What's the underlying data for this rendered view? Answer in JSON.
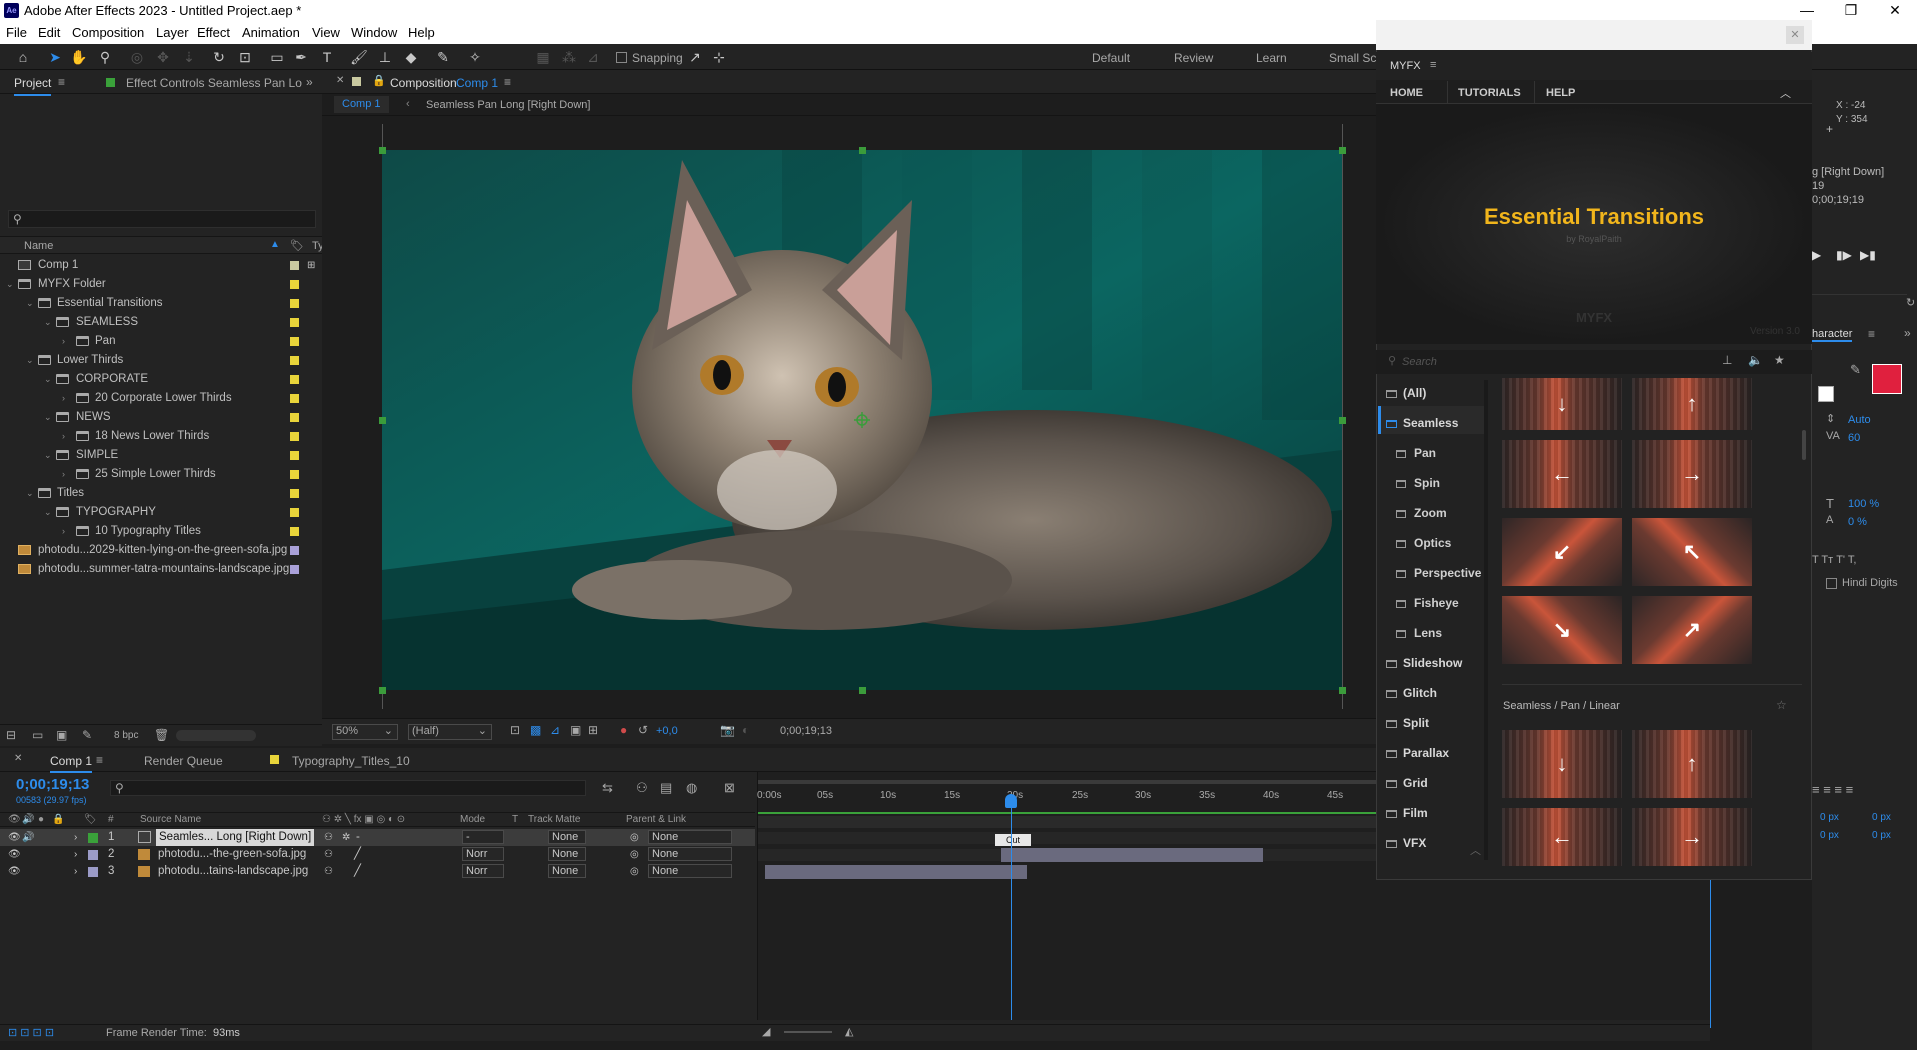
{
  "titlebar": {
    "title": "Adobe After Effects 2023 - Untitled Project.aep *",
    "logo": "Ae"
  },
  "menu": [
    "File",
    "Edit",
    "Composition",
    "Layer",
    "Effect",
    "Animation",
    "View",
    "Window",
    "Help"
  ],
  "toolbar": {
    "snapping": "Snapping",
    "workspaces": [
      "Default",
      "Review",
      "Learn",
      "Small Scr"
    ]
  },
  "project": {
    "tab_project": "Project",
    "tab_effect": "Effect Controls Seamless Pan Lo",
    "search_placeholder": "",
    "col_name": "Name",
    "col_type": "Ty",
    "items": [
      {
        "label": "Comp 1",
        "type": "comp"
      },
      {
        "label": "MYFX Folder",
        "type": "folder"
      },
      {
        "label": "Essential Transitions",
        "type": "folder"
      },
      {
        "label": "SEAMLESS",
        "type": "folder"
      },
      {
        "label": "Pan",
        "type": "folder"
      },
      {
        "label": "Lower Thirds",
        "type": "folder"
      },
      {
        "label": "CORPORATE",
        "type": "folder"
      },
      {
        "label": "20 Corporate Lower Thirds",
        "type": "folder"
      },
      {
        "label": "NEWS",
        "type": "folder"
      },
      {
        "label": "18 News Lower Thirds",
        "type": "folder"
      },
      {
        "label": "SIMPLE",
        "type": "folder"
      },
      {
        "label": "25 Simple Lower Thirds",
        "type": "folder"
      },
      {
        "label": "Titles",
        "type": "folder"
      },
      {
        "label": "TYPOGRAPHY",
        "type": "folder"
      },
      {
        "label": "10 Typography Titles",
        "type": "folder"
      },
      {
        "label": "photodu...2029-kitten-lying-on-the-green-sofa.jpg",
        "type": "image"
      },
      {
        "label": "photodu...summer-tatra-mountains-landscape.jpg",
        "type": "image"
      }
    ],
    "bpc": "8 bpc"
  },
  "composition": {
    "tab_label": "Composition",
    "tab_comp": "Comp 1",
    "breadcrumb_comp": "Comp 1",
    "breadcrumb_layer": "Seamless Pan Long [Right Down]",
    "zoom": "50%",
    "resolution": "(Half)",
    "exposure": "+0,0",
    "timecode": "0;00;19;13"
  },
  "timeline": {
    "tab_comp": "Comp 1",
    "tab_render": "Render Queue",
    "tab_typo": "Typography_Titles_10",
    "timecode": "0;00;19;13",
    "fps": "00583 (29.97 fps)",
    "col_source": "Source Name",
    "col_mode": "Mode",
    "col_t": "T",
    "col_track": "Track Matte",
    "col_parent": "Parent & Link",
    "ruler": [
      "0:00s",
      "05s",
      "10s",
      "15s",
      "20s",
      "25s",
      "30s",
      "35s",
      "40s",
      "45s"
    ],
    "layers": [
      {
        "num": "1",
        "name": "Seamles... Long [Right Down]",
        "mode": "-",
        "track": "None",
        "parent": "None",
        "color": "#3aa13a"
      },
      {
        "num": "2",
        "name": "photodu...-the-green-sofa.jpg",
        "mode": "Norr",
        "track": "None",
        "parent": "None",
        "color": "#9b9bc7"
      },
      {
        "num": "3",
        "name": "photodu...tains-landscape.jpg",
        "mode": "Norr",
        "track": "None",
        "parent": "None",
        "color": "#9b9bc7"
      }
    ],
    "render_label": "Frame Render Time:",
    "render_value": "93ms",
    "clip_label": "Cut"
  },
  "myfx": {
    "title": "MYFX",
    "nav": [
      "HOME",
      "TUTORIALS",
      "HELP"
    ],
    "banner_title": "Essential Transitions",
    "banner_sub": "by RoyalPaith",
    "banner_brand": "MYFX",
    "version": "Version 3.0",
    "search_placeholder": "Search",
    "categories": [
      "(All)",
      "Seamless",
      "Pan",
      "Spin",
      "Zoom",
      "Optics",
      "Perspective",
      "Fisheye",
      "Lens",
      "Slideshow",
      "Glitch",
      "Split",
      "Parallax",
      "Grid",
      "Film",
      "VFX"
    ],
    "section_label": "Seamless / Pan / Linear",
    "thumbs_top": [
      "↓",
      "↑",
      "←",
      "→",
      "↙",
      "↖",
      "↘",
      "↗"
    ],
    "thumbs_bottom": [
      "↓",
      "↑",
      "←",
      "→"
    ]
  },
  "right": {
    "coord_x": "X : -24",
    "coord_y": "Y : 354",
    "layer_frag": "g [Right Down]",
    "layer_frag2": "19",
    "time_frag": "0;00;19;19",
    "character_tab": "haracter",
    "auto": "Auto",
    "tracking": "60",
    "vscale": "100 %",
    "baseline": "0 %",
    "hindi": "Hindi Digits",
    "px1": "0 px",
    "px2": "0 px",
    "px3": "0 px",
    "px4": "0 px"
  },
  "colors": {
    "accent": "#2d8ceb",
    "green_handle": "#3b9c3b",
    "swatch_yellow": "#e8d43a",
    "swatch_lavender": "#a9a0d8",
    "fill_red": "#e0203e"
  }
}
